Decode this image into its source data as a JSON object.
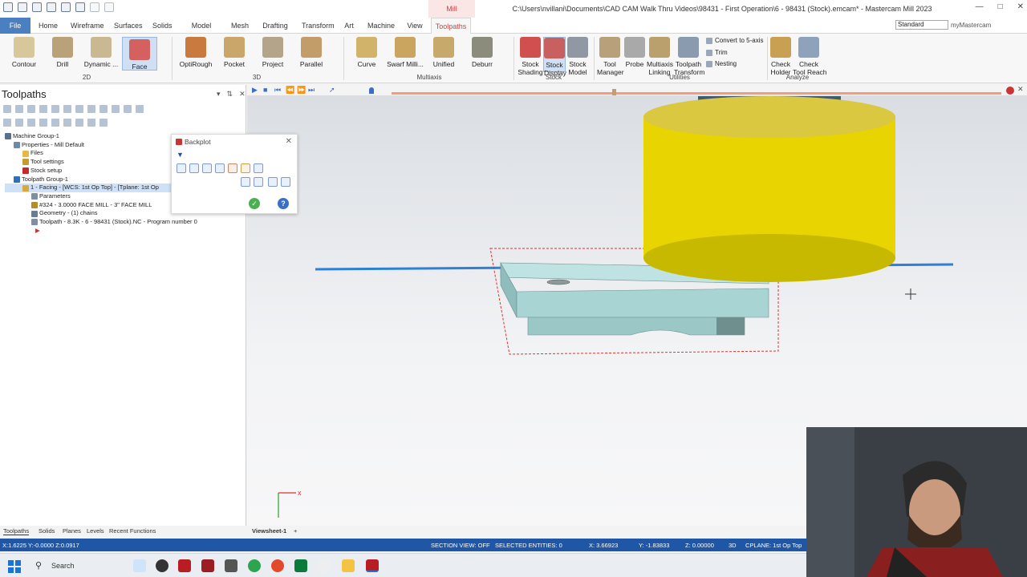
{
  "window": {
    "title": "C:\\Users\\nvillani\\Documents\\CAD CAM Walk Thru Videos\\98431 - First Operation\\6 - 98431 (Stock).emcam* - Mastercam Mill 2023",
    "context_tab": "Mill",
    "workspace": "Standard",
    "my_mastercam": "myMastercam"
  },
  "tabs": [
    "File",
    "Home",
    "Wireframe",
    "Surfaces",
    "Solids",
    "Model Prep",
    "Mesh",
    "Drafting",
    "Transform",
    "Art",
    "Machine",
    "View",
    "Toolpaths"
  ],
  "ribbon": {
    "2d": {
      "group": "2D",
      "buttons": [
        "Contour",
        "Drill",
        "Dynamic ...",
        "Face"
      ]
    },
    "3d": {
      "group": "3D",
      "buttons": [
        "OptiRough",
        "Pocket",
        "Project",
        "Parallel"
      ]
    },
    "multiaxis": {
      "group": "Multiaxis",
      "buttons": [
        "Curve",
        "Swarf Milli...",
        "Unified",
        "Deburr"
      ]
    },
    "stock": {
      "group": "Stock",
      "buttons": [
        "Stock\nShading",
        "Stock\nDisplay",
        "Stock\nModel"
      ]
    },
    "utilities": {
      "group": "Utilities",
      "buttons": [
        "Tool\nManager",
        "Probe",
        "Multiaxis\nLinking",
        "Toolpath\nTransform"
      ],
      "small": [
        "Convert to 5-axis",
        "Trim",
        "Nesting"
      ]
    },
    "analyze": {
      "group": "Analyze",
      "buttons": [
        "Check\nHolder",
        "Check\nTool Reach"
      ]
    }
  },
  "panel": {
    "title": "Toolpaths",
    "tree": [
      {
        "label": "Machine Group-1",
        "indent": 0,
        "icon": "machine-group-icon",
        "color": "#5a6f8e"
      },
      {
        "label": "Properties - Mill Default",
        "indent": 1,
        "icon": "properties-icon",
        "color": "#6f8aa8"
      },
      {
        "label": "Files",
        "indent": 2,
        "icon": "folder-icon",
        "color": "#e6b84a"
      },
      {
        "label": "Tool settings",
        "indent": 2,
        "icon": "tool-settings-icon",
        "color": "#c99a2e"
      },
      {
        "label": "Stock setup",
        "indent": 2,
        "icon": "stock-setup-icon",
        "color": "#c62828"
      },
      {
        "label": "Toolpath Group-1",
        "indent": 1,
        "icon": "toolpath-group-icon",
        "color": "#2e6fb8"
      },
      {
        "label": "1 - Facing - [WCS: 1st Op Top] - [Tplane: 1st Op",
        "indent": 2,
        "icon": "operation-icon",
        "color": "#d9a83c",
        "highlight": true
      },
      {
        "label": "Parameters",
        "indent": 3,
        "icon": "parameters-icon",
        "color": "#7d8fa6"
      },
      {
        "label": "#324 - 3.0000 FACE MILL - 3\" FACE MILL",
        "indent": 3,
        "icon": "tool-icon",
        "color": "#b88a2a"
      },
      {
        "label": "Geometry - (1) chains",
        "indent": 3,
        "icon": "geometry-icon",
        "color": "#6a7d96"
      },
      {
        "label": "Toolpath - 8.3K - 6 - 98431 (Stock).NC - Program number 0",
        "indent": 3,
        "icon": "toolpath-icon",
        "color": "#7d8fa6"
      }
    ]
  },
  "backplot": {
    "title": "Backplot"
  },
  "bottom_tabs": [
    "Toolpaths",
    "Solids",
    "Planes",
    "Levels",
    "Recent Functions"
  ],
  "viewsheet": {
    "tab": "Viewsheet-1",
    "add": "+"
  },
  "status": {
    "coords_left": "X:1.6225   Y:-0.0000   Z:0.0917",
    "section_view": "SECTION VIEW: OFF",
    "selected": "SELECTED ENTITIES: 0",
    "x": "X:   3.66923",
    "y": "Y:   -1.83833",
    "z": "Z:   0.00000",
    "mode": "3D",
    "cplane": "CPLANE: 1st Op Top"
  },
  "taskbar": {
    "search": "Search"
  },
  "colors": {
    "accent": "#1f56a6",
    "tool_yellow": "#e8d400",
    "part": "#a8d6d6"
  }
}
